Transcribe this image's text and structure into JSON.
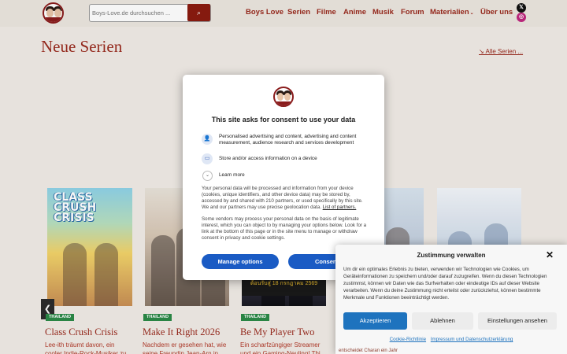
{
  "header": {
    "search_placeholder": "Boys-Love.de durchsuchen ...",
    "search_button": "⌕",
    "nav": [
      {
        "label": "Boys Love"
      },
      {
        "label": "Serien"
      },
      {
        "label": "Filme"
      },
      {
        "label": "Anime"
      },
      {
        "label": "Musik"
      },
      {
        "label": "Forum"
      },
      {
        "label": "Materialien"
      },
      {
        "label": "Über uns"
      }
    ],
    "social_x": "𝕏",
    "social_ig": "◎"
  },
  "main": {
    "title": "Neue Serien",
    "all_link": "↘ Alle Serien ...",
    "cards": [
      {
        "tag": "THAILAND",
        "title": "Class Crush Crisis",
        "desc": "Lee-ith träumt davon, ein cooler Indie-Rock-Musiker zu werden",
        "poster_text": "CLASS CRUSH CRISIS"
      },
      {
        "tag": "THAILAND",
        "title": "Make It Right 2026",
        "desc": "Nachdem er gesehen hat, wie seine Freundin Jean-Arn in Arm"
      },
      {
        "tag": "THAILAND",
        "title": "Be My Player Two",
        "desc": "Ein scharfzüngiger Streamer und ein Gaming-Neuling! Thi, ein",
        "poster_text": "ต้อนรับสู่ 18 กรกฎาคม 2569"
      },
      {
        "desc": "entscheidet Charan ein Jahr"
      }
    ]
  },
  "consent_modal": {
    "heading": "This site asks for consent to use your data",
    "purposes": [
      {
        "icon": "person-icon",
        "text": "Personalised advertising and content, advertising and content measurement, audience research and services development"
      },
      {
        "icon": "device-icon",
        "text": "Store and/or access information on a device"
      }
    ],
    "learn_more": "Learn more",
    "body1": "Your personal data will be processed and information from your device (cookies, unique identifiers, and other device data) may be stored by, accessed by and shared with 210 partners, or used specifically by this site. We and our partners may use precise geolocation data.",
    "body1_link": "List of partners.",
    "body2": "Some vendors may process your personal data on the basis of legitimate interest, which you can object to by managing your options below. Look for a link at the bottom of this page or in the site menu to manage or withdraw consent in privacy and cookie settings.",
    "manage_button": "Manage options",
    "consent_button": "Consent"
  },
  "cookie_panel": {
    "title": "Zustimmung verwalten",
    "close": "✕",
    "text": "Um dir ein optimales Erlebnis zu bieten, verwenden wir Technologien wie Cookies, um Geräteinformationen zu speichern und/oder darauf zuzugreifen. Wenn du diesen Technologien zustimmst, können wir Daten wie das Surfverhalten oder eindeutige IDs auf dieser Website verarbeiten. Wenn du deine Zustimmung nicht erteilst oder zurückziehst, können bestimmte Merkmale und Funktionen beeinträchtigt werden.",
    "accept": "Akzeptieren",
    "deny": "Ablehnen",
    "prefs": "Einstellungen ansehen",
    "link1": "Cookie-Richtlinie",
    "link2": "Impressum und Datenschutzerklärung"
  },
  "colors": {
    "brand_red": "#9a2a1e",
    "consent_blue": "#1a5bc4",
    "cookie_blue": "#1e73be",
    "tag_green": "#2b8a47"
  }
}
